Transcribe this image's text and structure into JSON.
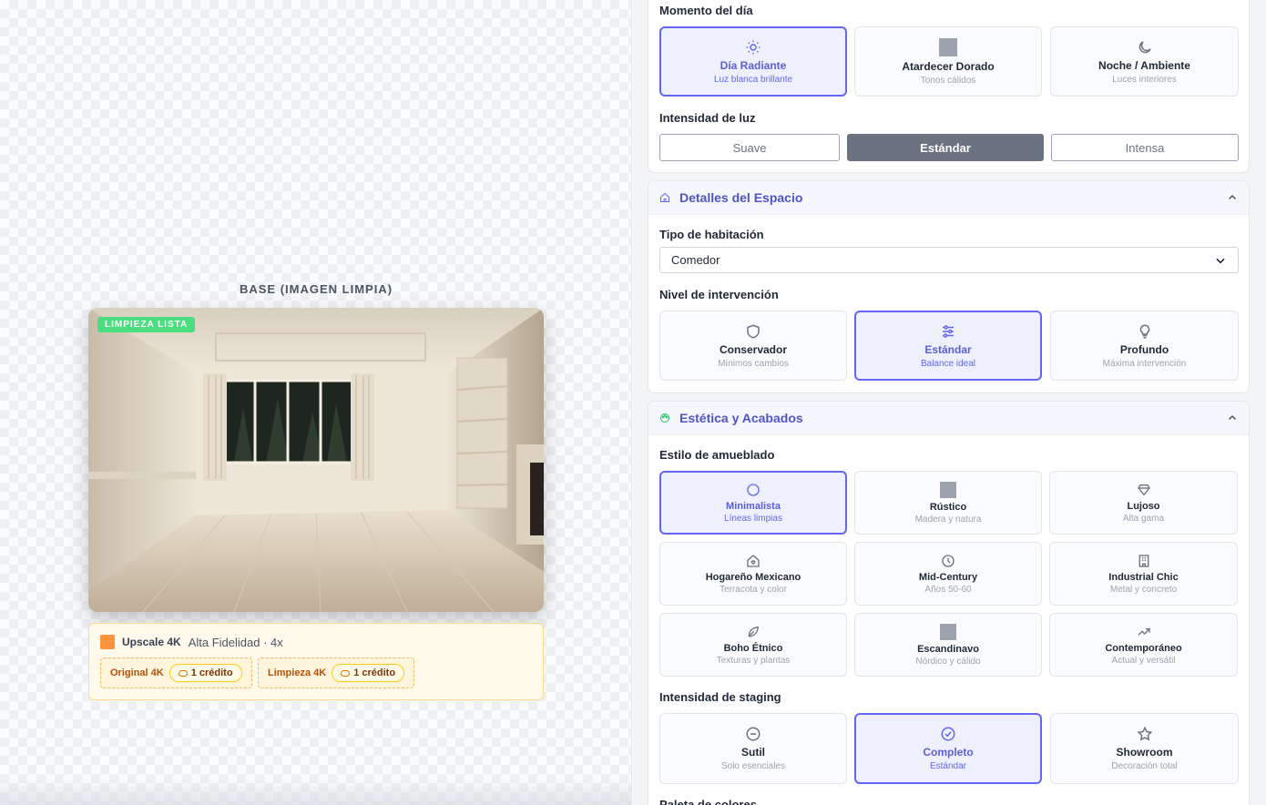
{
  "preview": {
    "title": "BASE (IMAGEN LIMPIA)",
    "badge": "LIMPIEZA LISTA",
    "upscale": {
      "name": "Upscale 4K",
      "subtitle": "Alta Fidelidad · 4x",
      "chips": [
        {
          "label": "Original 4K",
          "credit": "1 crédito"
        },
        {
          "label": "Limpieza 4K",
          "credit": "1 crédito"
        }
      ]
    }
  },
  "lighting": {
    "moment_label": "Momento del día",
    "moments": [
      {
        "title": "Día Radiante",
        "sub": "Luz blanca brillante",
        "icon": "sun-icon",
        "selected": true
      },
      {
        "title": "Atardecer Dorado",
        "sub": "Tonos cálidos",
        "icon": "image-placeholder-icon",
        "selected": false
      },
      {
        "title": "Noche / Ambiente",
        "sub": "Luces interiores",
        "icon": "moon-icon",
        "selected": false
      }
    ],
    "intensity_label": "Intensidad de luz",
    "intensity": [
      {
        "label": "Suave",
        "selected": false
      },
      {
        "label": "Estándar",
        "selected": true
      },
      {
        "label": "Intensa",
        "selected": false
      }
    ]
  },
  "space": {
    "title": "Detalles del Espacio",
    "room_label": "Tipo de habitación",
    "room_value": "Comedor",
    "level_label": "Nivel de intervención",
    "levels": [
      {
        "title": "Conservador",
        "sub": "Mínimos cambios",
        "icon": "shield-icon",
        "selected": false
      },
      {
        "title": "Estándar",
        "sub": "Balance ideal",
        "icon": "sliders-icon",
        "selected": true
      },
      {
        "title": "Profundo",
        "sub": "Máxima intervención",
        "icon": "lightbulb-icon",
        "selected": false
      }
    ]
  },
  "aesthetics": {
    "title": "Estética y Acabados",
    "style_label": "Estilo de amueblado",
    "styles": [
      {
        "title": "Minimalista",
        "sub": "Líneas limpias",
        "icon": "circle-icon",
        "selected": true
      },
      {
        "title": "Rústico",
        "sub": "Madera y natura",
        "icon": "image-placeholder-icon",
        "selected": false
      },
      {
        "title": "Lujoso",
        "sub": "Alta gama",
        "icon": "gem-icon",
        "selected": false
      },
      {
        "title": "Hogareño Mexicano",
        "sub": "Terracota y color",
        "icon": "home-heart-icon",
        "selected": false
      },
      {
        "title": "Mid-Century",
        "sub": "Años 50-60",
        "icon": "clock-icon",
        "selected": false
      },
      {
        "title": "Industrial Chic",
        "sub": "Metal y concreto",
        "icon": "building-icon",
        "selected": false
      },
      {
        "title": "Boho Étnico",
        "sub": "Texturas y plantas",
        "icon": "leaf-icon",
        "selected": false
      },
      {
        "title": "Escandinavo",
        "sub": "Nórdico y cálido",
        "icon": "image-placeholder-icon",
        "selected": false
      },
      {
        "title": "Contemporáneo",
        "sub": "Actual y versátil",
        "icon": "trending-up-icon",
        "selected": false
      }
    ],
    "staging_label": "Intensidad de staging",
    "staging": [
      {
        "title": "Sutil",
        "sub": "Solo esenciales",
        "icon": "minus-circle-icon",
        "selected": false
      },
      {
        "title": "Completo",
        "sub": "Estándar",
        "icon": "check-circle-icon",
        "selected": true
      },
      {
        "title": "Showroom",
        "sub": "Decoración total",
        "icon": "star-icon",
        "selected": false
      }
    ],
    "palette_label": "Paleta de colores"
  }
}
